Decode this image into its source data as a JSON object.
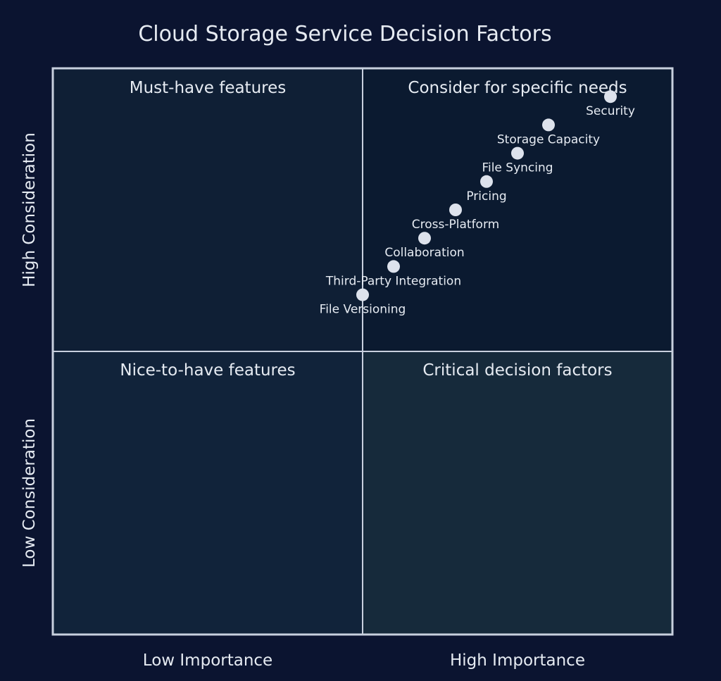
{
  "chart_data": {
    "type": "scatter",
    "subtype": "quadrant",
    "title": "Cloud Storage Service Decision Factors",
    "x_axis": {
      "low_label": "Low Importance",
      "high_label": "High Importance",
      "range": [
        0,
        1
      ]
    },
    "y_axis": {
      "low_label": "Low Consideration",
      "high_label": "High Consideration",
      "range": [
        0,
        1
      ]
    },
    "quadrants": {
      "top_left": {
        "label": "Must-have features",
        "color": "#0f1f35"
      },
      "top_right": {
        "label": "Consider for specific needs",
        "color": "#0b1a30"
      },
      "bottom_left": {
        "label": "Nice-to-have features",
        "color": "#11233a"
      },
      "bottom_right": {
        "label": "Critical decision factors",
        "color": "#162a3b"
      }
    },
    "points": [
      {
        "name": "Security",
        "x": 0.9,
        "y": 0.95
      },
      {
        "name": "Storage Capacity",
        "x": 0.8,
        "y": 0.9
      },
      {
        "name": "File Syncing",
        "x": 0.75,
        "y": 0.85
      },
      {
        "name": "Pricing",
        "x": 0.7,
        "y": 0.8
      },
      {
        "name": "Cross-Platform",
        "x": 0.65,
        "y": 0.75
      },
      {
        "name": "Collaboration",
        "x": 0.6,
        "y": 0.7
      },
      {
        "name": "Third-Party Integration",
        "x": 0.55,
        "y": 0.65
      },
      {
        "name": "File Versioning",
        "x": 0.5,
        "y": 0.6
      }
    ],
    "colors": {
      "background": "#0b1430",
      "border": "#c8d0de",
      "point": "#dde2ec",
      "text": "#e6ebf2"
    }
  }
}
